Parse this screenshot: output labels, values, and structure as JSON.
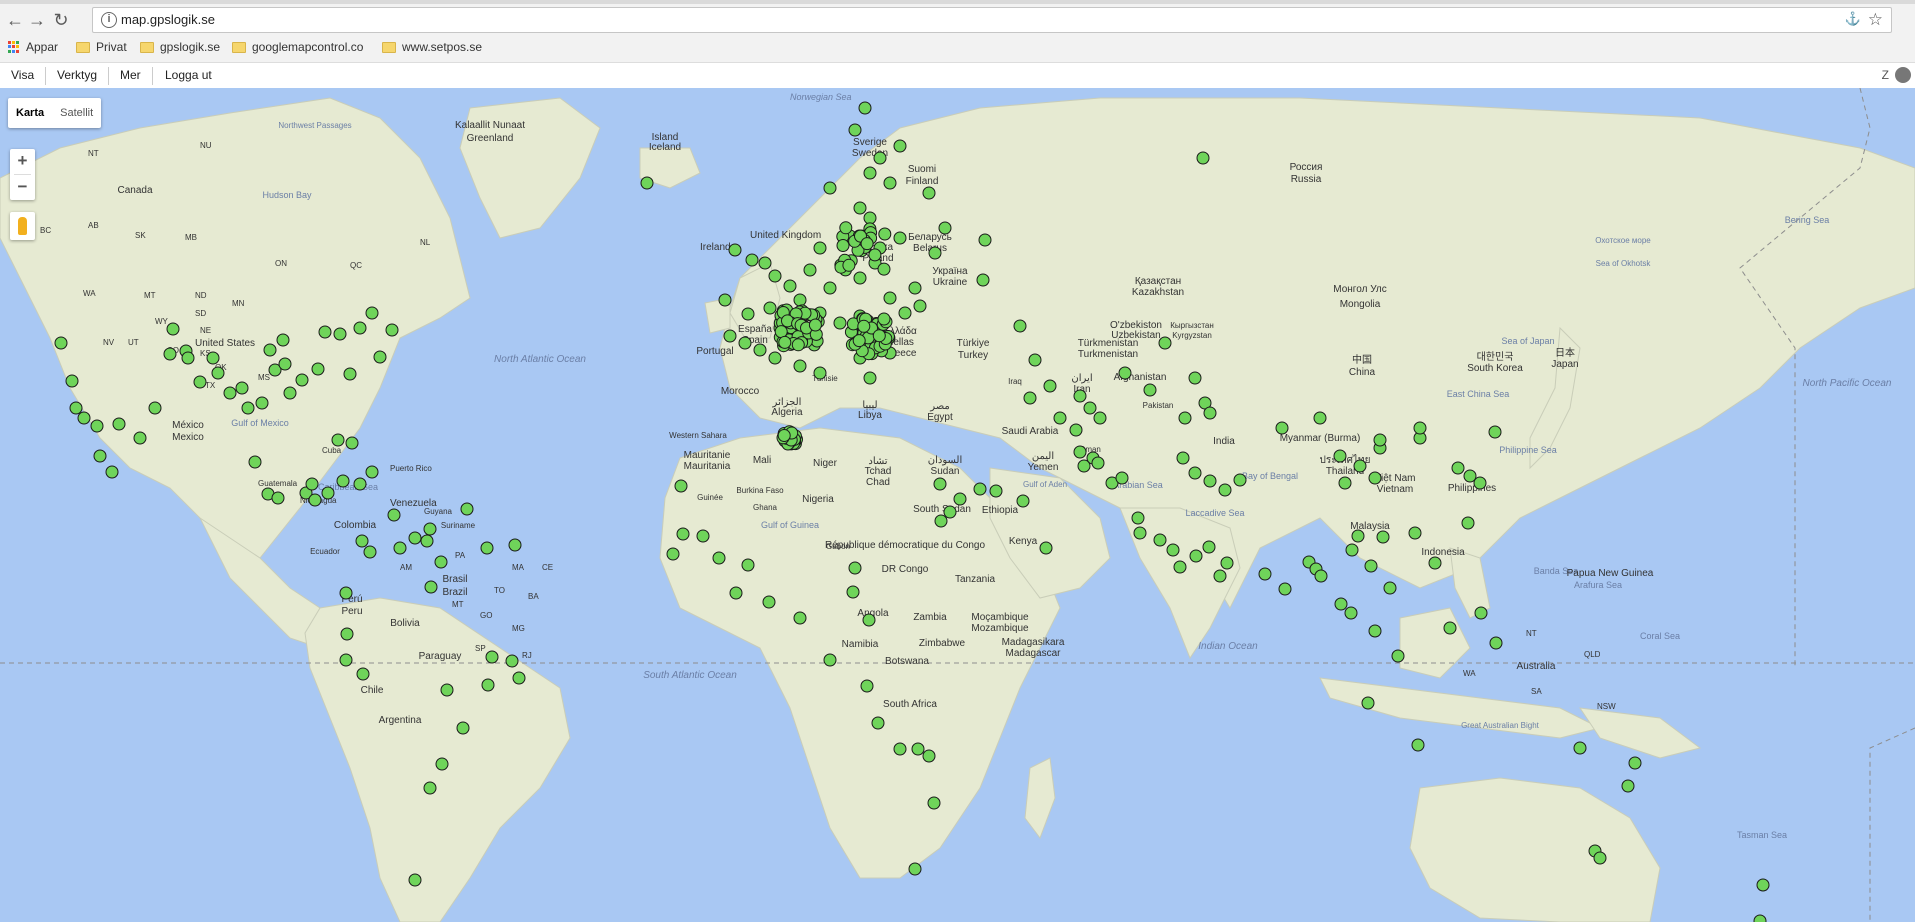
{
  "browser": {
    "url": "map.gpslogik.se",
    "bookmarks": [
      "Appar",
      "Privat",
      "gpslogik.se",
      "googlemapcontrol.co",
      "www.setpos.se"
    ]
  },
  "menu": {
    "items": [
      "Visa",
      "Verktyg",
      "Mer",
      "Logga ut"
    ],
    "right_text": "Z"
  },
  "map": {
    "type_buttons": [
      "Karta",
      "Satellit"
    ],
    "active_type": "Karta",
    "zoom_in": "+",
    "zoom_out": "−",
    "colors": {
      "water": "#a9c8f3",
      "land": "#e8ebd6",
      "marker": "#6fd45a",
      "marker_stroke": "#1a1a1a"
    },
    "labels": [
      "Norwegian Sea",
      "Kalaallit Nunaat",
      "Greenland",
      "Island",
      "Iceland",
      "Northwest Passages",
      "Canada",
      "Hudson Bay",
      "NT",
      "NU",
      "BC",
      "AB",
      "SK",
      "MB",
      "ON",
      "QC",
      "NL",
      "WA",
      "MT",
      "ND",
      "MN",
      "SD",
      "WY",
      "NE",
      "NV",
      "UT",
      "CO",
      "KS",
      "United States",
      "TX",
      "OK",
      "MS",
      "México",
      "Mexico",
      "Gulf of Mexico",
      "Cuba",
      "Puerto Rico",
      "Guatemala",
      "Nicaragua",
      "Caribbean Sea",
      "North Atlantic Ocean",
      "Venezuela",
      "Colombia",
      "Guyana",
      "Suriname",
      "Ecuador",
      "Perú",
      "Peru",
      "Brasil",
      "Brazil",
      "Bolivia",
      "Paraguay",
      "Chile",
      "Argentina",
      "AM",
      "PA",
      "MA",
      "CE",
      "BA",
      "MT",
      "GO",
      "MG",
      "SP",
      "TO",
      "RJ",
      "South Atlantic Ocean",
      "Sverige",
      "Sweden",
      "Suomi",
      "Finland",
      "Ireland",
      "United Kingdom",
      "Polska",
      "Poland",
      "Беларусь",
      "Belarus",
      "Україна",
      "Ukraine",
      "España",
      "Spain",
      "Portugal",
      "Ελλάδα",
      "Hellas",
      "Greece",
      "Türkiye",
      "Turkey",
      "Tunisie",
      "Morocco",
      "Algeria",
      "الجزائر",
      "Libya",
      "ليبيا",
      "Egypt",
      "مصر",
      "Western Sahara",
      "Mauritanie",
      "Mauritania",
      "Mali",
      "Niger",
      "Tchad",
      "Chad",
      "تشاد",
      "السودان",
      "Sudan",
      "Burkina Faso",
      "Guinée",
      "Ghana",
      "Nigeria",
      "South Sudan",
      "Ethiopia",
      "Gulf of Guinea",
      "Gabon",
      "République démocratique du Congo",
      "DR Congo",
      "Kenya",
      "Tanzania",
      "Angola",
      "Zambia",
      "Moçambique",
      "Mozambique",
      "Namibia",
      "Botswana",
      "Zimbabwe",
      "South Africa",
      "Madagasikara",
      "Madagascar",
      "Gulf of Aden",
      "Saudi Arabia",
      "Yemen",
      "اليمن",
      "Oman",
      "Iran",
      "ایران",
      "Iraq",
      "Afghanistan",
      "Pakistan",
      "India",
      "Россия",
      "Russia",
      "Қазақстан",
      "Kazakhstan",
      "O'zbekiston",
      "Uzbekistan",
      "Türkmenistan",
      "Turkmenistan",
      "Кыргызстан",
      "Kyrgyzstan",
      "Монгол Улс",
      "Mongolia",
      "中国",
      "China",
      "대한민국",
      "South Korea",
      "日本",
      "Japan",
      "Sea of Japan",
      "Охотское море",
      "Sea of Okhotsk",
      "Bering Sea",
      "North Pacific Ocean",
      "East China Sea",
      "Philippine Sea",
      "Philippines",
      "Myanmar (Burma)",
      "ประเทศไทย",
      "Thailand",
      "Việt Nam",
      "Vietnam",
      "Malaysia",
      "Indonesia",
      "Bay of Bengal",
      "Arabian Sea",
      "Laccadive Sea",
      "Indian Ocean",
      "Banda Sea",
      "Arafura Sea",
      "Papua New Guinea",
      "Coral Sea",
      "Australia",
      "WA",
      "NT",
      "QLD",
      "SA",
      "NSW",
      "Great Australian Bight",
      "Tasman Sea"
    ]
  }
}
